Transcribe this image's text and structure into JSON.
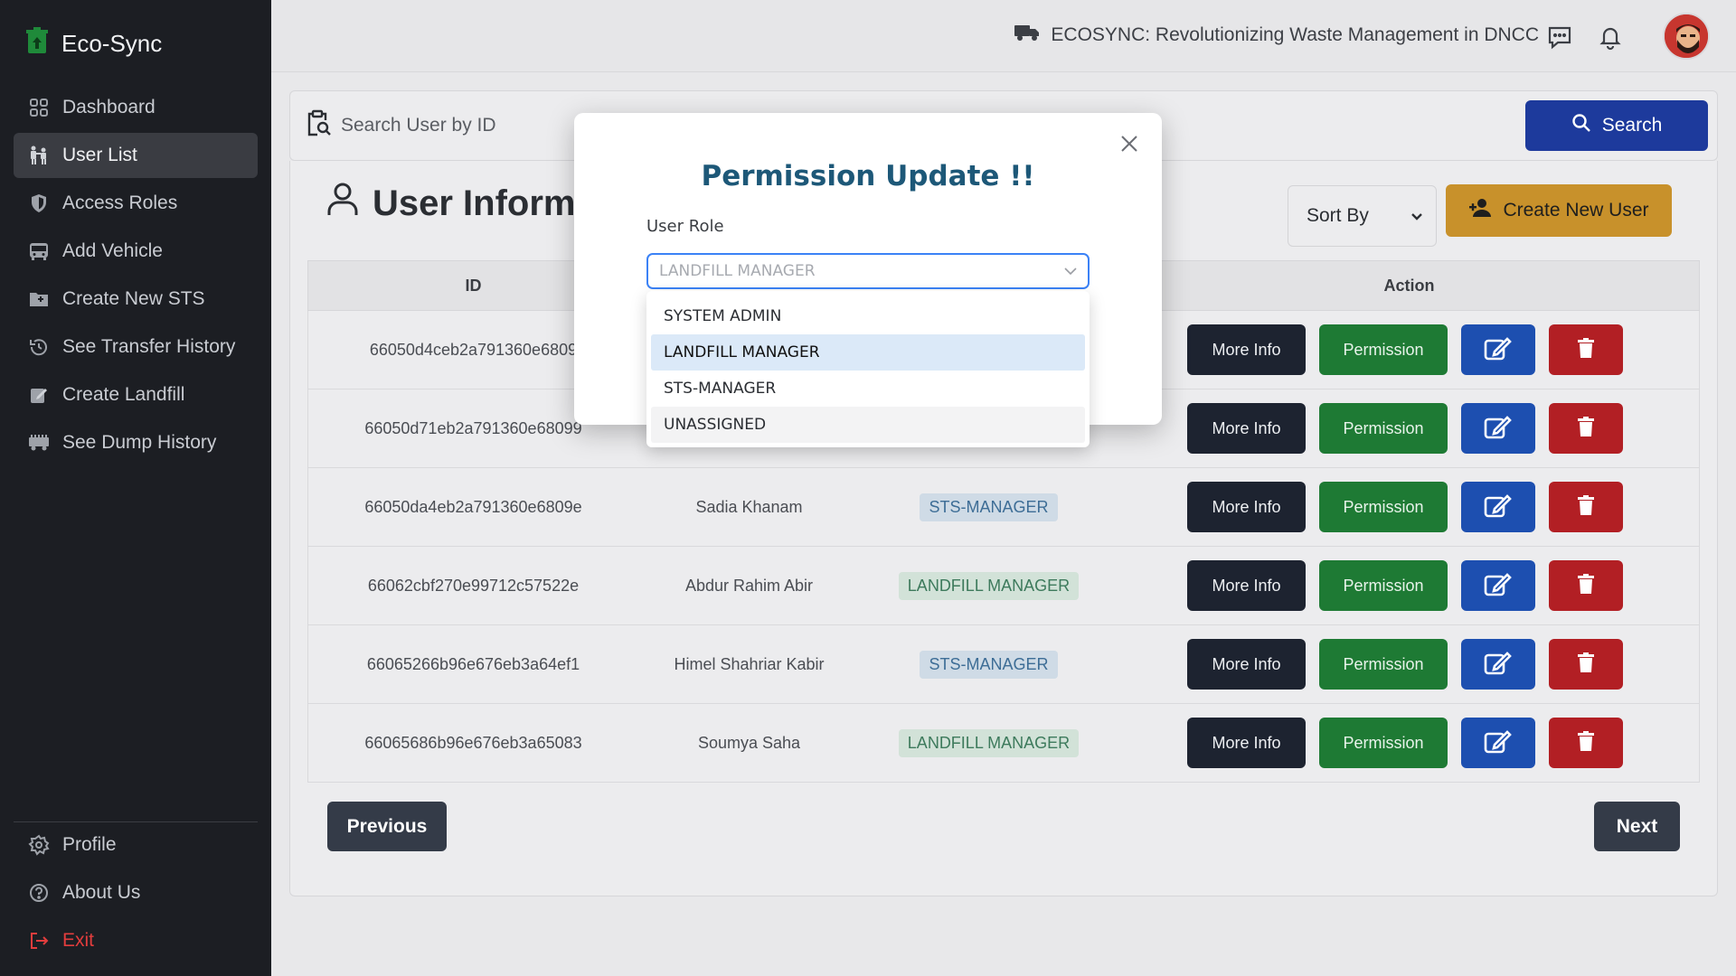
{
  "app": {
    "name": "Eco-Sync"
  },
  "sidebar": {
    "items": [
      {
        "label": "Dashboard",
        "icon": "dashboard-icon"
      },
      {
        "label": "User List",
        "icon": "users-icon",
        "active": true
      },
      {
        "label": "Access Roles",
        "icon": "shield-icon"
      },
      {
        "label": "Add Vehicle",
        "icon": "bus-icon"
      },
      {
        "label": "Create New STS",
        "icon": "folder-plus-icon"
      },
      {
        "label": "See Transfer History",
        "icon": "history-icon"
      },
      {
        "label": "Create Landfill",
        "icon": "edit-square-icon"
      },
      {
        "label": "See Dump History",
        "icon": "truck-icon"
      }
    ],
    "bottom": [
      {
        "label": "Profile",
        "icon": "gear-icon"
      },
      {
        "label": "About Us",
        "icon": "question-icon"
      },
      {
        "label": "Exit",
        "icon": "logout-icon"
      }
    ]
  },
  "topbar": {
    "title": "ECOSYNC: Revolutionizing Waste Management in DNCC"
  },
  "search": {
    "placeholder": "Search User by ID",
    "button_label": "Search"
  },
  "page": {
    "heading": "User Informa",
    "sort_label": "Sort By",
    "create_label": "Create New User"
  },
  "table": {
    "headers": {
      "id": "ID",
      "action": "Action"
    },
    "rows": [
      {
        "id": "66050d4ceb2a791360e6809",
        "name": "",
        "role": "",
        "role_type": ""
      },
      {
        "id": "66050d71eb2a791360e68099",
        "name": "",
        "role": "",
        "role_type": ""
      },
      {
        "id": "66050da4eb2a791360e6809e",
        "name": "Sadia Khanam",
        "role": "STS-MANAGER",
        "role_type": "sts"
      },
      {
        "id": "66062cbf270e99712c57522e",
        "name": "Abdur Rahim Abir",
        "role": "LANDFILL MANAGER",
        "role_type": "land"
      },
      {
        "id": "66065266b96e676eb3a64ef1",
        "name": "Himel Shahriar Kabir",
        "role": "STS-MANAGER",
        "role_type": "sts"
      },
      {
        "id": "66065686b96e676eb3a65083",
        "name": "Soumya Saha",
        "role": "LANDFILL MANAGER",
        "role_type": "land"
      }
    ],
    "more_info_label": "More Info",
    "permission_label": "Permission"
  },
  "pagination": {
    "previous": "Previous",
    "next": "Next"
  },
  "modal": {
    "title": "Permission Update !!",
    "label": "User Role",
    "selected_value": "LANDFILL MANAGER",
    "options": [
      "SYSTEM ADMIN",
      "LANDFILL MANAGER",
      "STS-MANAGER",
      "UNASSIGNED"
    ]
  },
  "colors": {
    "sidebar_bg": "#1c1e23",
    "primary_blue": "#1d3a9c",
    "permission_green": "#1e7a34",
    "delete_red": "#b21f24",
    "create_gold": "#c8912b",
    "modal_title": "#1d5878"
  }
}
